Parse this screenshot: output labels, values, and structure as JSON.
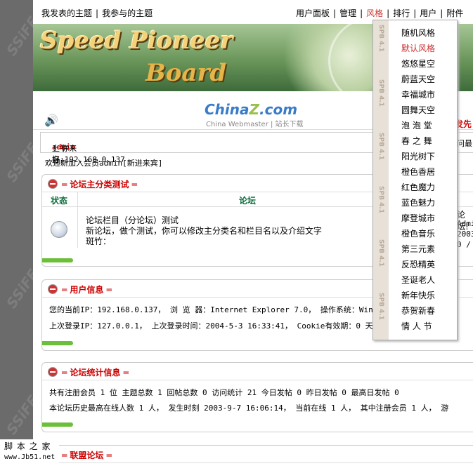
{
  "topbar": {
    "my_topics": "我发表的主题",
    "joined_topics": "我参与的主题",
    "nav": [
      "用户面板",
      "管理",
      "风格",
      "排行",
      "用户",
      "附件"
    ]
  },
  "banner": {
    "line1": "Speed Pioneer",
    "line2": "Board"
  },
  "logo": {
    "brand": "China",
    "brand_z": "Z",
    "brand_tail": ".com",
    "sub": "China Webmaster | 站长下载"
  },
  "right_peek": {
    "r1": "发先(",
    "r2": "问最",
    "r3": "论坛!",
    "r4": "Admi",
    "r5": "2003-",
    "r6": "0 /"
  },
  "greeting": {
    "prefix": "上午好，",
    "user": "admin",
    "suffix": "! 你来自:192.168.0.137"
  },
  "welcome": "欢迎新加入会员admin[新进来宾]",
  "forum_panel": {
    "title": "论坛主分类测试",
    "col_status": "状态",
    "col_forum": "论坛",
    "forum_name": "论坛栏目（分论坛）测试",
    "forum_desc": "新论坛，做个测试，你可以修改主分类名和栏目名以及介绍文字",
    "moderator": "斑竹："
  },
  "user_panel": {
    "title": "用户信息",
    "line1": "您的当前IP：192.168.0.137，  浏 览 器：Internet Explorer 7.0，  操作系统：Win",
    "line2": "上次登录IP：127.0.0.1，  上次登录时间：2004-5-3 16:33:41，  Cookie有效期：0 天"
  },
  "stats_panel": {
    "title": "论坛统计信息",
    "line1": "共有注册会员 1 位  主题总数 1  回帖总数 0  访问统计 21      今日发帖 0  昨日发帖 0  最高日发帖 0",
    "line2": "本论坛历史最高在线人数 1 人，  发生时刻 2003-9-7 16:06:14，  当前在线 1 人，  其中注册会员 1 人，  游"
  },
  "allied_panel": {
    "title": "联盟论坛"
  },
  "watermark": {
    "line1": "脚 本 之 家",
    "line2": "www.Jb51.net"
  },
  "style_menu": {
    "side_label": "SPB 4.1",
    "items": [
      "随机风格",
      "默认风格",
      "悠悠星空",
      "蔚蓝天空",
      "幸福城市",
      "圆舞天空",
      "泡 泡 堂",
      "春 之 舞",
      "阳光树下",
      "橙色香居",
      "红色魔力",
      "蓝色魅力",
      "摩登城市",
      "橙色音乐",
      "第三元素",
      "反恐精英",
      "圣诞老人",
      "新年快乐",
      "恭贺新春",
      "情 人 节"
    ],
    "selected_index": 1
  },
  "colors": {
    "accent_red": "#cc0000",
    "green_bar": "#6cbf3a",
    "left_bar": "#6b6b6b"
  }
}
